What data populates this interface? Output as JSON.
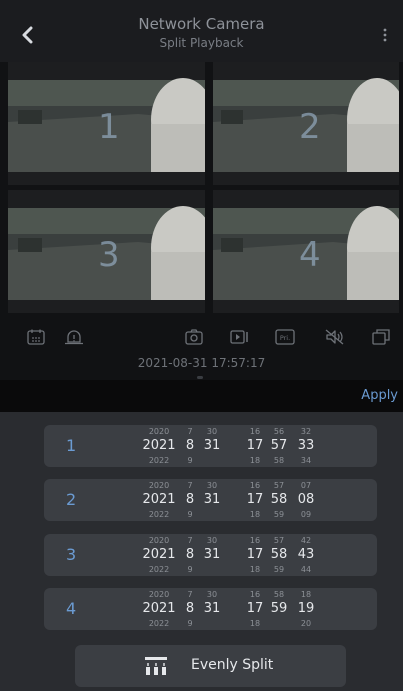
{
  "header": {
    "title": "Network Camera",
    "subtitle": "Split Playback"
  },
  "icons": {
    "back": "chevron-left-icon",
    "menu": "more-vertical-icon",
    "toolbar": [
      "calendar-icon",
      "alarm-bell-icon",
      "camera-icon",
      "record-video-icon",
      "pri-icon",
      "mute-icon",
      "split-icon"
    ]
  },
  "toolbar": {
    "pri_label": "Pri."
  },
  "video_cells": [
    {
      "label": "1"
    },
    {
      "label": "2"
    },
    {
      "label": "3"
    },
    {
      "label": "4"
    }
  ],
  "timestamp": "2021-08-31 17:57:17",
  "apply_label": "Apply",
  "segments": [
    {
      "label": "1",
      "year": [
        "2020",
        "2021",
        "2022"
      ],
      "month": [
        "7",
        "8",
        "9"
      ],
      "day": [
        "30",
        "31",
        ""
      ],
      "hour": [
        "16",
        "17",
        "18"
      ],
      "minute": [
        "56",
        "57",
        "58"
      ],
      "second": [
        "32",
        "33",
        "34"
      ]
    },
    {
      "label": "2",
      "year": [
        "2020",
        "2021",
        "2022"
      ],
      "month": [
        "7",
        "8",
        "9"
      ],
      "day": [
        "30",
        "31",
        ""
      ],
      "hour": [
        "16",
        "17",
        "18"
      ],
      "minute": [
        "57",
        "58",
        "59"
      ],
      "second": [
        "07",
        "08",
        "09"
      ]
    },
    {
      "label": "3",
      "year": [
        "2020",
        "2021",
        "2022"
      ],
      "month": [
        "7",
        "8",
        "9"
      ],
      "day": [
        "30",
        "31",
        ""
      ],
      "hour": [
        "16",
        "17",
        "18"
      ],
      "minute": [
        "57",
        "58",
        "59"
      ],
      "second": [
        "42",
        "43",
        "44"
      ]
    },
    {
      "label": "4",
      "year": [
        "2020",
        "2021",
        "2022"
      ],
      "month": [
        "7",
        "8",
        "9"
      ],
      "day": [
        "30",
        "31",
        ""
      ],
      "hour": [
        "16",
        "17",
        "18"
      ],
      "minute": [
        "58",
        "59",
        ""
      ],
      "second": [
        "18",
        "19",
        "20"
      ]
    }
  ],
  "even_split_label": "Evenly Split",
  "colors": {
    "accent": "#6b9bd2",
    "background": "#111214",
    "panel": "#2a2c30",
    "row": "#3b3e43"
  }
}
